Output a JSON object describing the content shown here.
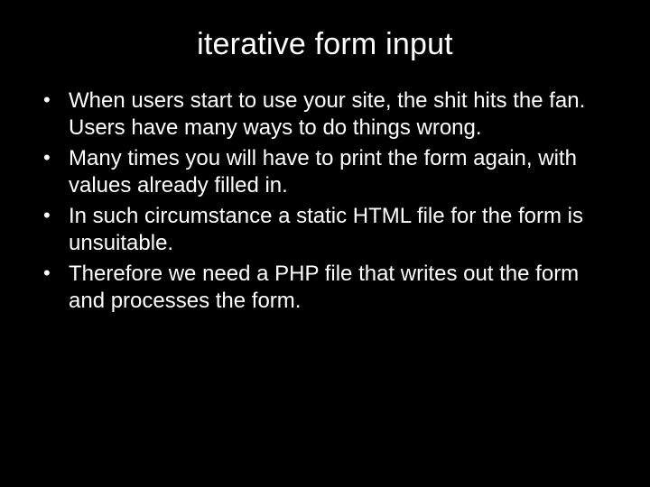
{
  "slide": {
    "title": "iterative form input",
    "bullets": [
      "When users start to use your site, the shit hits the fan. Users have many ways to do things wrong.",
      "Many times you will have to print the form again, with values already filled in.",
      "In such circumstance a static HTML file for the form is unsuitable.",
      "Therefore we need a PHP file that writes out the form and processes the form."
    ]
  }
}
